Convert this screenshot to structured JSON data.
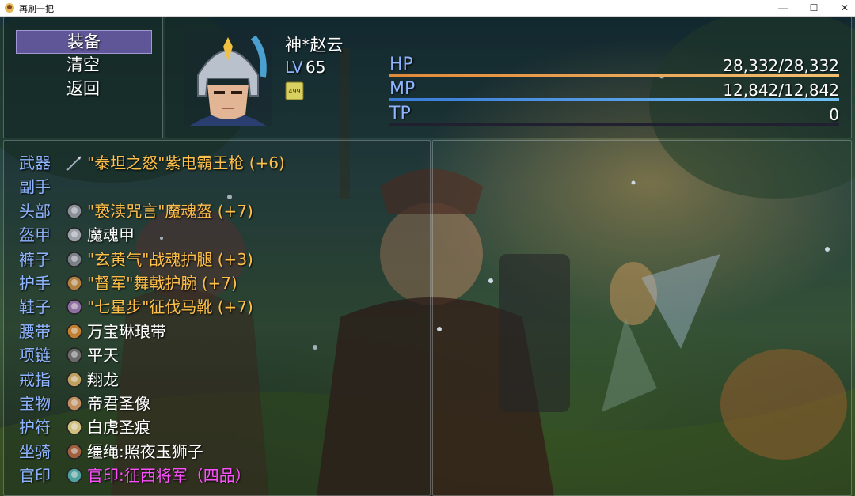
{
  "window": {
    "title": "再刷一把",
    "minimize": "—",
    "maximize": "☐",
    "close": "✕"
  },
  "commands": [
    {
      "label": "装备",
      "selected": true
    },
    {
      "label": "清空",
      "selected": false
    },
    {
      "label": "返回",
      "selected": false
    }
  ],
  "actor": {
    "name": "神*赵云",
    "level_label": "LV",
    "level": "65",
    "hp_label": "HP",
    "hp": "28,332/28,332",
    "hp_ratio": 1.0,
    "mp_label": "MP",
    "mp": "12,842/12,842",
    "mp_ratio": 1.0,
    "tp_label": "TP",
    "tp": "0",
    "tp_ratio": 0.0,
    "state_icon_text": "499"
  },
  "colors": {
    "hp_gauge": [
      "#e08a3a",
      "#f4c070"
    ],
    "mp_gauge": [
      "#3a7ad8",
      "#70c0f4"
    ],
    "tp_gauge": [
      "#40a040",
      "#9ae070"
    ],
    "slot_label": "#8fb4ff",
    "item_orange": "#ffc04a",
    "item_magenta": "#ff50ff"
  },
  "equipment": [
    {
      "slot": "武器",
      "item": "\"泰坦之怒\"紫电霸王枪 (+6)",
      "color": "orange",
      "icon": "spear-icon"
    },
    {
      "slot": "副手",
      "item": "",
      "color": "white",
      "icon": ""
    },
    {
      "slot": "头部",
      "item": "\"亵渎咒言\"魔魂盔 (+7)",
      "color": "orange",
      "icon": "helmet-icon"
    },
    {
      "slot": "盔甲",
      "item": "魔魂甲",
      "color": "white",
      "icon": "armor-icon"
    },
    {
      "slot": "裤子",
      "item": "\"玄黄气\"战魂护腿 (+3)",
      "color": "orange",
      "icon": "leggings-icon"
    },
    {
      "slot": "护手",
      "item": "\"督军\"舞戟护腕 (+7)",
      "color": "orange",
      "icon": "gauntlet-icon"
    },
    {
      "slot": "鞋子",
      "item": "\"七星步\"征伐马靴 (+7)",
      "color": "orange",
      "icon": "boots-icon"
    },
    {
      "slot": "腰带",
      "item": "万宝琳琅带",
      "color": "white",
      "icon": "belt-icon"
    },
    {
      "slot": "项链",
      "item": "平天",
      "color": "white",
      "icon": "necklace-icon"
    },
    {
      "slot": "戒指",
      "item": "翔龙",
      "color": "white",
      "icon": "ring-icon"
    },
    {
      "slot": "宝物",
      "item": "帝君圣像",
      "color": "white",
      "icon": "statue-icon"
    },
    {
      "slot": "护符",
      "item": "白虎圣痕",
      "color": "white",
      "icon": "talisman-icon"
    },
    {
      "slot": "坐骑",
      "item": "缰绳:照夜玉狮子",
      "color": "white",
      "icon": "rein-icon"
    },
    {
      "slot": "官印",
      "item": "官印:征西将军（四品）",
      "color": "magenta",
      "icon": "seal-icon"
    }
  ]
}
